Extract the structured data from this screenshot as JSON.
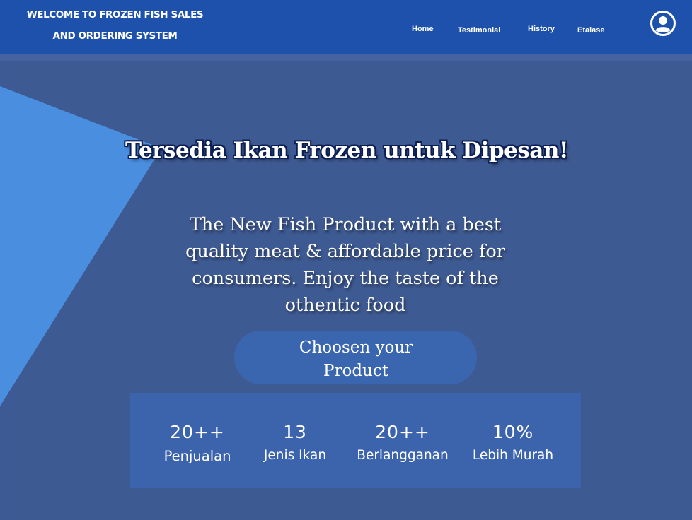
{
  "header": {
    "brand_line1": "WELCOME TO FROZEN FISH SALES",
    "brand_line2": "AND ORDERING SYSTEM",
    "nav": [
      {
        "label": "Home"
      },
      {
        "label": "Testimonial"
      },
      {
        "label": "History"
      },
      {
        "label": "Etalase"
      }
    ],
    "account_icon": "user-circle-icon"
  },
  "hero": {
    "headline": "Tersedia Ikan Frozen untuk Dipesan!",
    "subtitle": "The New Fish Product with a best quality meat & affordable price for consumers. Enjoy the taste of the othentic food",
    "cta_label": "Choosen your Product"
  },
  "stats": [
    {
      "value": "20++",
      "label": "Penjualan"
    },
    {
      "value": "13",
      "label": "Jenis Ikan"
    },
    {
      "value": "20++",
      "label": "Berlangganan"
    },
    {
      "value": "10%",
      "label": "Lebih Murah"
    }
  ],
  "colors": {
    "header_bg": "#1d51ab",
    "page_bg": "#3e5a92",
    "accent_triangle": "#4a8ee0",
    "stats_bg": "#3b64ad",
    "button_bg": "#3a66b0",
    "text": "#ffffff"
  }
}
